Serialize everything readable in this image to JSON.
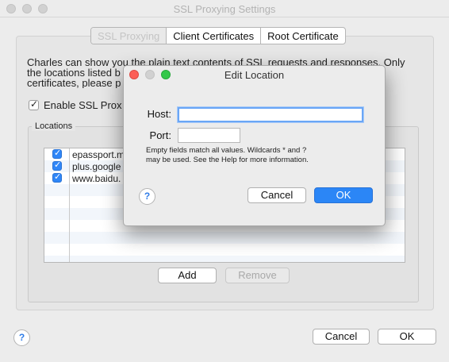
{
  "window": {
    "title": "SSL Proxying Settings"
  },
  "tabs": [
    {
      "label": "SSL Proxying",
      "active": true
    },
    {
      "label": "Client Certificates",
      "active": false
    },
    {
      "label": "Root Certificate",
      "active": false
    }
  ],
  "description": {
    "line1": "Charles can show you the plain text contents of SSL requests and responses. Only",
    "line2": "the locations listed b",
    "line3": "certificates, please p"
  },
  "enable": {
    "label": "Enable SSL Prox",
    "checked": true
  },
  "locations": {
    "legend": "Locations",
    "rows": [
      {
        "text": "epassport.m",
        "checked": true
      },
      {
        "text": "plus.google",
        "checked": true
      },
      {
        "text": "www.baidu.",
        "checked": true
      }
    ],
    "add_label": "Add",
    "remove_label": "Remove"
  },
  "footer": {
    "help": "?",
    "cancel_label": "Cancel",
    "ok_label": "OK"
  },
  "dialog": {
    "title": "Edit Location",
    "host_label": "Host:",
    "host_value": "",
    "port_label": "Port:",
    "port_value": "",
    "hint": "Empty fields match all values. Wildcards * and ? may be used. See the Help for more information.",
    "help": "?",
    "cancel_label": "Cancel",
    "ok_label": "OK"
  },
  "colors": {
    "accent": "#2b86f6",
    "close": "#fc5f57",
    "minimize": "#d6d6d6",
    "zoom": "#34c84a"
  }
}
